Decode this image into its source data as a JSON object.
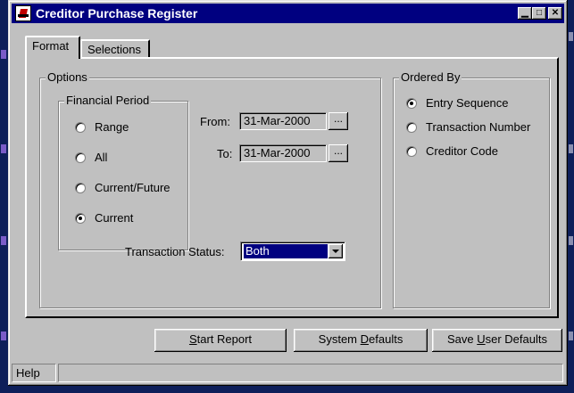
{
  "window": {
    "title": "Creditor Purchase Register",
    "controls": {
      "minimize": "▁",
      "maximize": "□",
      "close": "✕"
    }
  },
  "tabs": [
    {
      "label": "Format",
      "active": true
    },
    {
      "label": "Selections",
      "active": false
    }
  ],
  "options": {
    "legend": "Options",
    "financial_period": {
      "legend": "Financial Period",
      "items": [
        {
          "label": "Range",
          "selected": false
        },
        {
          "label": "All",
          "selected": false
        },
        {
          "label": "Current/Future",
          "selected": false
        },
        {
          "label": "Current",
          "selected": true
        }
      ]
    },
    "from_label": "From:",
    "from_value": "31-Mar-2000",
    "to_label": "To:",
    "to_value": "31-Mar-2000",
    "browse_label": "...",
    "transaction_status_label": "Transaction Status:",
    "transaction_status_value": "Both"
  },
  "ordered_by": {
    "legend": "Ordered By",
    "items": [
      {
        "label": "Entry Sequence",
        "selected": true
      },
      {
        "label": "Transaction Number",
        "selected": false
      },
      {
        "label": "Creditor Code",
        "selected": false
      }
    ]
  },
  "buttons": {
    "start_report": {
      "accel": "S",
      "rest": "tart Report"
    },
    "system_defaults": {
      "pre": "System ",
      "accel": "D",
      "rest": "efaults"
    },
    "save_user_defaults": {
      "pre": "Save ",
      "accel": "U",
      "rest": "ser Defaults"
    }
  },
  "status_bar": {
    "help": "Help",
    "message": ""
  },
  "colors": {
    "titlebar": "#000080",
    "face": "#c0c0c0",
    "selection": "#000080"
  }
}
